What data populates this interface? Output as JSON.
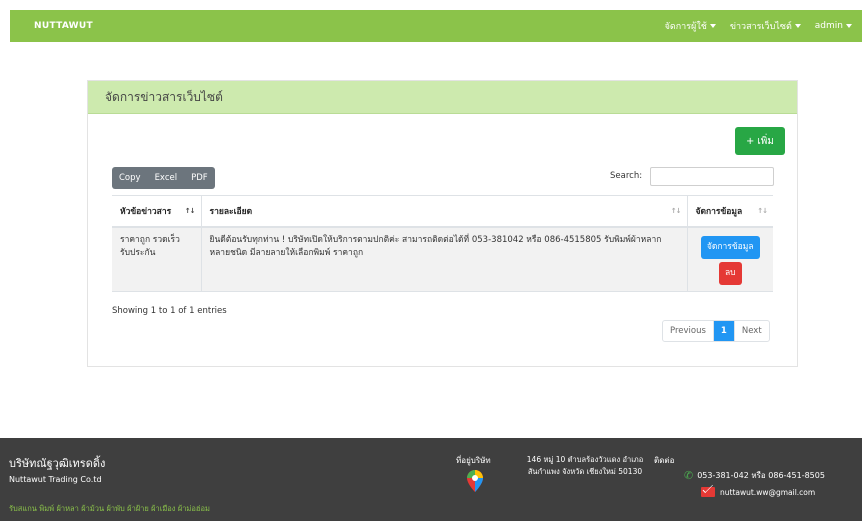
{
  "nav": {
    "brand": "NUTTAWUT",
    "items": [
      {
        "label": "จัดการผู้ใช้"
      },
      {
        "label": "ข่าวสารเว็บไซต์"
      },
      {
        "label": "admin"
      }
    ]
  },
  "card": {
    "title": "จัดการข่าวสารเว็บไซต์",
    "add_label": "เพิ่ม",
    "export": {
      "copy": "Copy",
      "excel": "Excel",
      "pdf": "PDF"
    },
    "search_label": "Search:",
    "search_value": "",
    "table": {
      "headers": [
        "หัวข้อข่าวสาร",
        "รายละเอียด",
        "จัดการข้อมูล"
      ],
      "rows": [
        {
          "title": "ราคาถูก รวดเร็ว รับประกัน",
          "detail": "ยินดีต้อนรับทุกท่าน ! บริษัทเปิดให้บริการตามปกติค่ะ สามารถติดต่อได้ที่ 053-381042 หรือ 086-4515805 รับพิมพ์ผ้าหลากหลายชนิด มีลายลายให้เลือกพิมพ์ ราคาถูก",
          "manage_label": "จัดการข้อมูล",
          "delete_label": "ลบ"
        }
      ]
    },
    "info": "Showing 1 to 1 of 1 entries",
    "pager": {
      "prev": "Previous",
      "current": "1",
      "next": "Next"
    }
  },
  "footer": {
    "company_th": "บริษัทณัฐวุฒิเทรดดิ้ง",
    "company_en": "Nuttawut Trading Co.td",
    "products": "รับสแกน พิมพ์ ผ้าหลา ผ้าม้วน ผ้าพับ ผ้าฝ้าย ผ้าเมือง ผ้าม่อฮ่อม",
    "location_title": "ที่อยู่บริษัท",
    "address": "146 หมู่ 10 ตำบลร้องวัวแดง อำเภอสันกำแพง จังหวัด เชียงใหม่ 50130",
    "contact_title": "ติดต่อ",
    "phone": "053-381-042 หรือ 086-451-8505",
    "email": "nuttawut.ww@gmail.com"
  },
  "colors": {
    "navbar": "#8bc34a",
    "header": "#cdeaae",
    "add": "#28a745",
    "primary": "#2196f3",
    "danger": "#e53935",
    "footer": "#3f3f3f"
  }
}
